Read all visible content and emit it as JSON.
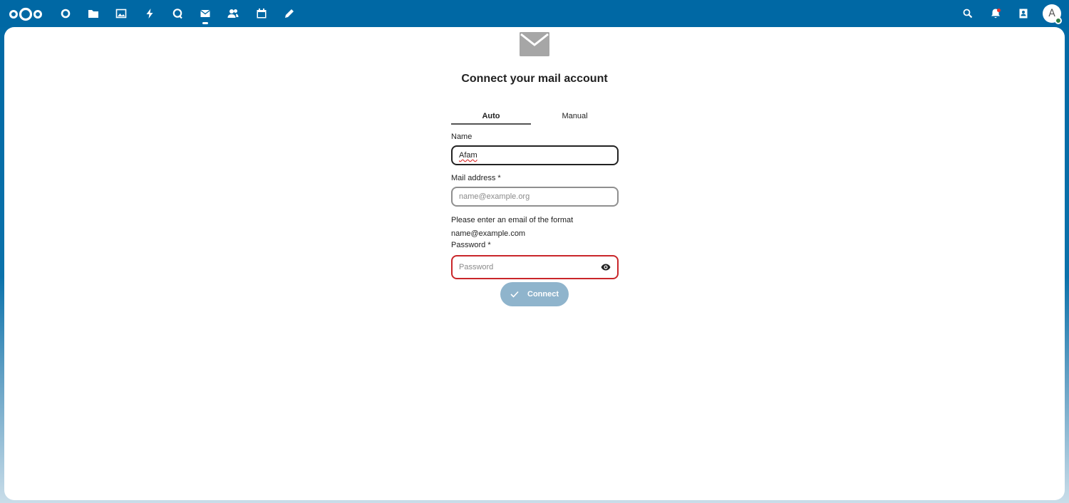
{
  "header": {
    "logo_icon": "nextcloud-logo-icon",
    "apps": [
      {
        "name": "dashboard",
        "icon": "circle-icon",
        "active": false
      },
      {
        "name": "files",
        "icon": "folder-icon",
        "active": false
      },
      {
        "name": "photos",
        "icon": "image-icon",
        "active": false
      },
      {
        "name": "activity",
        "icon": "lightning-icon",
        "active": false
      },
      {
        "name": "talk",
        "icon": "chat-icon",
        "active": false
      },
      {
        "name": "mail",
        "icon": "envelope-icon",
        "active": true
      },
      {
        "name": "contacts",
        "icon": "people-icon",
        "active": false
      },
      {
        "name": "calendar",
        "icon": "calendar-icon",
        "active": false
      },
      {
        "name": "notes",
        "icon": "pencil-icon",
        "active": false
      }
    ],
    "right_icons": [
      "search-icon",
      "bell-icon",
      "contacts-book-icon"
    ],
    "avatar_letter": "A",
    "colors": {
      "header_bg": "#0068a4",
      "status_online": "#2d7b41",
      "notification": "#e9322d"
    }
  },
  "main": {
    "title": "Connect your mail account",
    "tabs": [
      {
        "label": "Auto",
        "active": true
      },
      {
        "label": "Manual",
        "active": false
      }
    ],
    "form": {
      "name_label": "Name",
      "name_value": "Afam",
      "mail_label": "Mail address *",
      "mail_placeholder": "name@example.org",
      "mail_help_line1": "Please enter an email of the format",
      "mail_help_line2": "name@example.com",
      "password_label": "Password *",
      "password_placeholder": "Password",
      "connect_label": "Connect"
    },
    "colors": {
      "error_border": "#c9262a",
      "button_disabled": "#8fb4cc"
    }
  }
}
